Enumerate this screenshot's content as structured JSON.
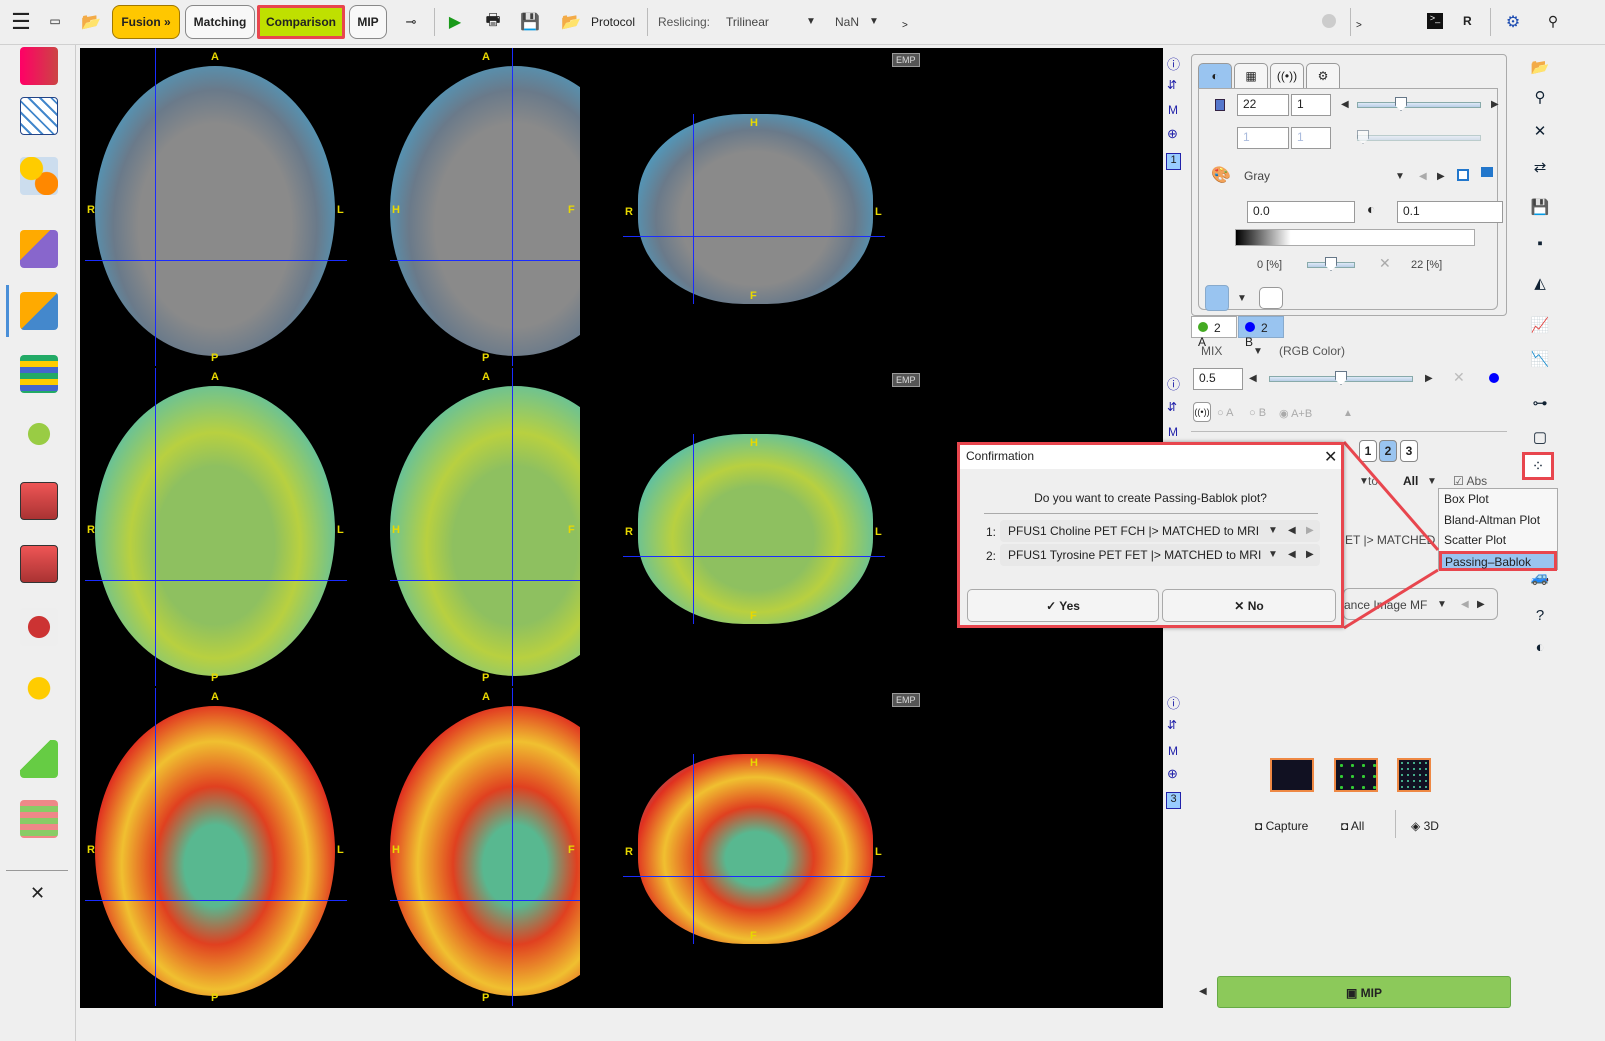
{
  "toolbar": {
    "fusion": "Fusion »",
    "matching": "Matching",
    "comparison": "Comparison",
    "mip": "MIP",
    "protocol": "Protocol",
    "reslicing_label": "Reslicing:",
    "reslicing_value": "Trilinear",
    "nan_value": "NaN",
    "more": ">",
    "r_label": "R"
  },
  "viewer": {
    "emp": "EMP",
    "orient": {
      "A": "A",
      "P": "P",
      "R": "R",
      "L": "L",
      "H": "H",
      "F": "F"
    }
  },
  "panel": {
    "tabs": [
      "contrast",
      "layout",
      "fusion",
      "settings"
    ],
    "slice_value": "22",
    "slice_step": "1",
    "frame_value": "1",
    "frame_step": "1",
    "colormap": "Gray",
    "min_value": "0.0",
    "max_value": "0.1",
    "pct_min": "0 [%]",
    "pct_max": "22 [%]",
    "series_a": "2 A",
    "series_b": "2 B",
    "mix_mode": "MIX",
    "mix_desc": "(RGB Color)",
    "mix_value": "0.5",
    "radio_a": "A",
    "radio_b": "B",
    "radio_ab": "A+B",
    "pages": [
      "1",
      "2",
      "3"
    ],
    "to_label": "to",
    "all_value": "All",
    "abs_label": "Abs",
    "series_truncated": "ET |> MATCHED",
    "ref_truncated": "ance Image MF",
    "viewport1": "1",
    "viewport3": "3",
    "capture": "Capture",
    "all": "All",
    "three_d": "3D",
    "mip_button": "MIP",
    "mix_level": 0.5,
    "slice_level": 0.4
  },
  "plot_menu": {
    "items": [
      "Box Plot",
      "Bland-Altman Plot",
      "Scatter Plot",
      "Passing–Bablok"
    ],
    "selected": "Passing–Bablok"
  },
  "dialog": {
    "title": "Confirmation",
    "question": "Do you want to create Passing-Bablok plot?",
    "rows": [
      {
        "num": "1:",
        "value": "PFUS1 Choline PET FCH |> MATCHED to MRI"
      },
      {
        "num": "2:",
        "value": "PFUS1 Tyrosine PET FET |> MATCHED to MRI"
      }
    ],
    "yes": "Yes",
    "no": "No"
  },
  "colors": {
    "fusion": "#ffc700",
    "comparison": "#bfe000",
    "highlight": "#e8464e",
    "mip": "#8cc95a",
    "selected": "#99c4f0"
  }
}
